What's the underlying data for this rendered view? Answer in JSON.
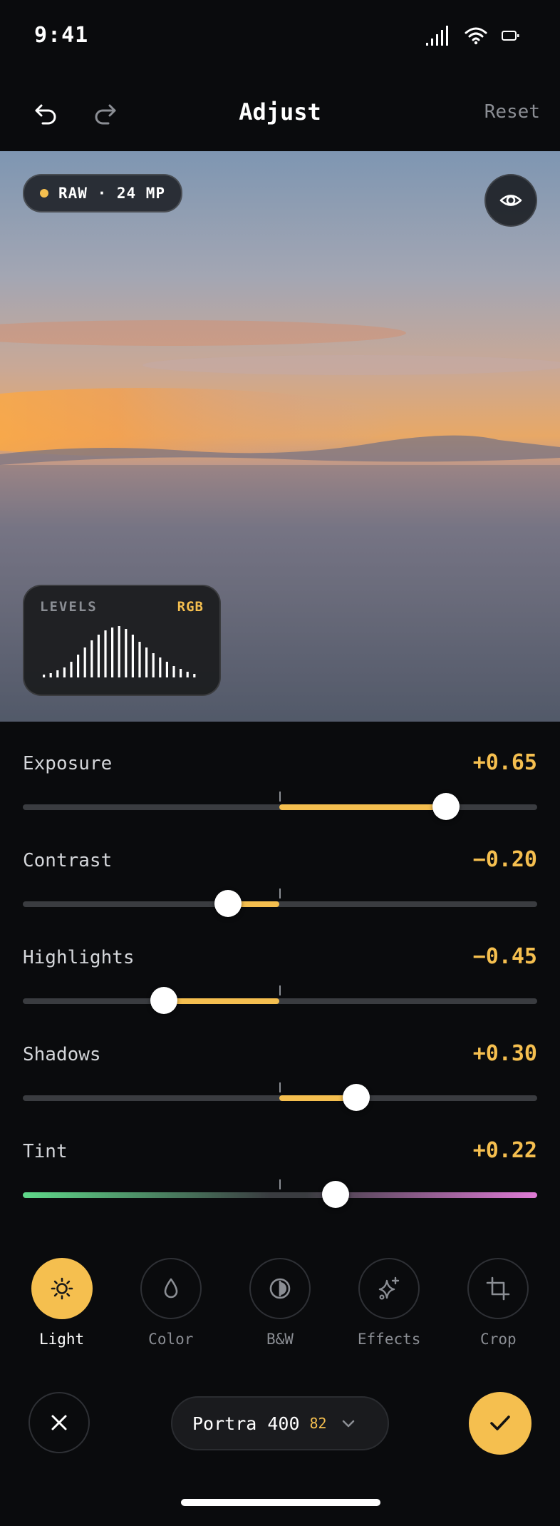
{
  "status_bar": {
    "time": "9:41"
  },
  "header": {
    "title": "Adjust",
    "reset_label": "Reset"
  },
  "photo": {
    "badge": "RAW · 24 MP",
    "levels": {
      "label": "LEVELS",
      "mode": "RGB"
    }
  },
  "sliders": [
    {
      "label": "Exposure",
      "value_text": "+0.65",
      "value": 0.65
    },
    {
      "label": "Contrast",
      "value_text": "−0.20",
      "value": -0.2
    },
    {
      "label": "Highlights",
      "value_text": "−0.45",
      "value": -0.45
    },
    {
      "label": "Shadows",
      "value_text": "+0.30",
      "value": 0.3
    },
    {
      "label": "Tint",
      "value_text": "+0.22",
      "value": 0.22
    }
  ],
  "tools": [
    {
      "label": "Light",
      "icon": "sun-icon",
      "active": true
    },
    {
      "label": "Color",
      "icon": "drop-icon",
      "active": false
    },
    {
      "label": "B&W",
      "icon": "contrast-icon",
      "active": false
    },
    {
      "label": "Effects",
      "icon": "sparkles-icon",
      "active": false
    },
    {
      "label": "Crop",
      "icon": "crop-icon",
      "active": false
    }
  ],
  "preset": {
    "name": "Portra 400",
    "strength": "82"
  },
  "colors": {
    "accent": "#f5bf4f",
    "background": "#0a0b0d",
    "tint_green": "#5fd98a",
    "tint_magenta": "#e07bd6"
  }
}
